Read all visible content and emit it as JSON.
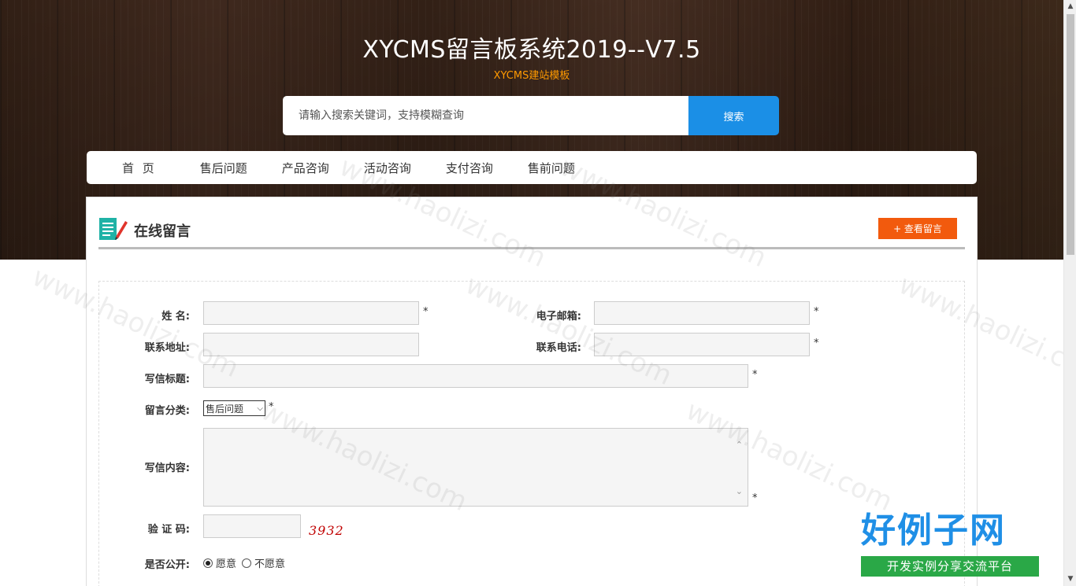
{
  "header": {
    "site_title": "XYCMS留言板系统2019--V7.5",
    "site_subtitle": "XYCMS建站模板"
  },
  "search": {
    "placeholder": "请输入搜索关键词，支持模糊查询",
    "button_label": "搜索"
  },
  "nav": {
    "items": [
      {
        "label": "首 页"
      },
      {
        "label": "售后问题"
      },
      {
        "label": "产品咨询"
      },
      {
        "label": "活动咨询"
      },
      {
        "label": "支付咨询"
      },
      {
        "label": "售前问题"
      }
    ]
  },
  "panel": {
    "title": "在线留言",
    "view_button": "+ 查看留言"
  },
  "form": {
    "name_label": "姓 名:",
    "email_label": "电子邮箱:",
    "address_label": "联系地址:",
    "phone_label": "联系电话:",
    "subject_label": "写信标题:",
    "category_label": "留言分类:",
    "category_selected": "售后问题",
    "content_label": "写信内容:",
    "captcha_label": "验 证 码:",
    "captcha_code": "3932",
    "public_label": "是否公开:",
    "public_yes": "愿意",
    "public_no": "不愿意",
    "required_mark": "*"
  },
  "watermark": {
    "text": "www.haolizi.com",
    "logo_main": "好例子网",
    "logo_sub": "开发实例分享交流平台"
  },
  "colors": {
    "accent_blue": "#1b8fe6",
    "accent_orange": "#f25a0d",
    "subtitle_orange": "#ff9a00"
  }
}
